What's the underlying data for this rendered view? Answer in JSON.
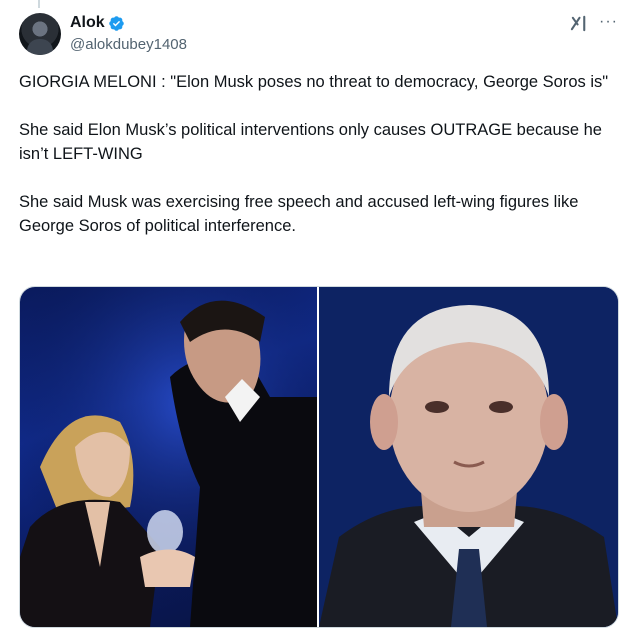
{
  "author": {
    "name": "Alok",
    "handle": "@alokdubey1408",
    "verified": true,
    "verified_color": "#1d9bf0"
  },
  "header_icons": {
    "grok": "grok-icon",
    "more": "more-icon",
    "more_glyph": "···"
  },
  "tweet": {
    "paragraphs": [
      "GIORGIA MELONI : \"Elon Musk poses no threat to democracy, George Soros is\"",
      "She said  Elon Musk’s political interventions only causes OUTRAGE because he isn’t LEFT-WING",
      "She said Musk was exercising free speech and accused left-wing figures like George Soros of political interference."
    ]
  },
  "media": {
    "images": [
      "photo-meloni-musk",
      "photo-soros"
    ]
  }
}
